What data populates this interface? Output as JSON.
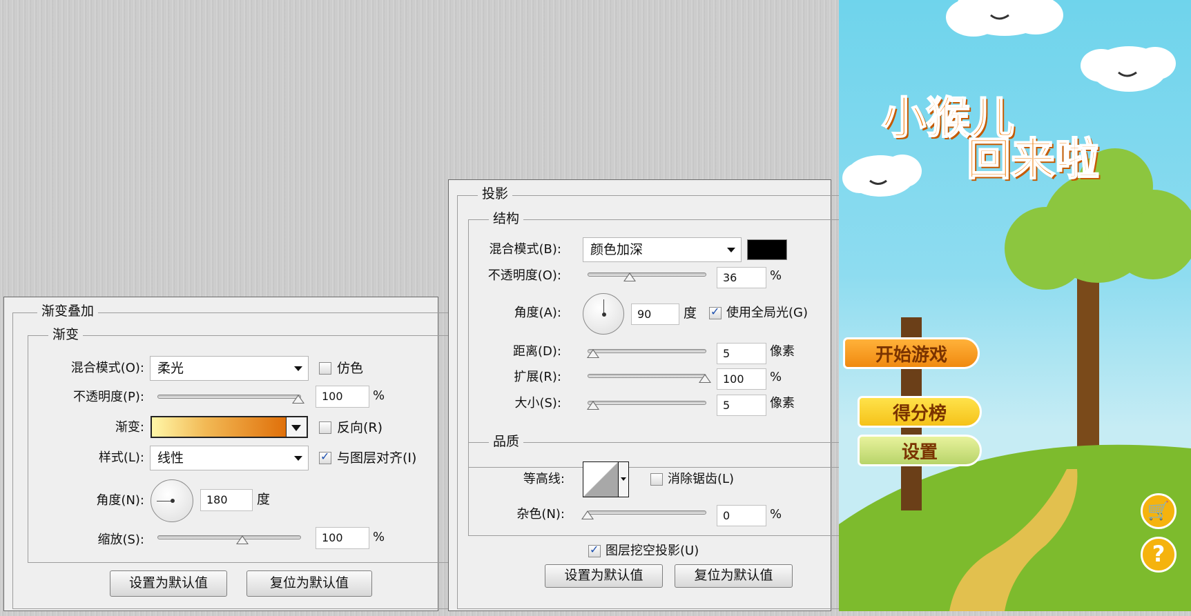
{
  "gradient_overlay": {
    "title": "渐变叠加",
    "section": "渐变",
    "blend_mode_label": "混合模式(O):",
    "blend_mode_value": "柔光",
    "dither_label": "仿色",
    "dither_checked": false,
    "opacity_label": "不透明度(P):",
    "opacity_value": "100",
    "opacity_unit": "%",
    "gradient_label": "渐变:",
    "gradient_colors": [
      "#fff7a8",
      "#f2b955",
      "#e0700a"
    ],
    "reverse_label": "反向(R)",
    "reverse_checked": false,
    "style_label": "样式(L):",
    "style_value": "线性",
    "align_label": "与图层对齐(I)",
    "align_checked": true,
    "angle_label": "角度(N):",
    "angle_value": "180",
    "angle_unit": "度",
    "scale_label": "缩放(S):",
    "scale_value": "100",
    "scale_unit": "%",
    "set_default_label": "设置为默认值",
    "reset_default_label": "复位为默认值"
  },
  "drop_shadow": {
    "title": "投影",
    "structure_section": "结构",
    "blend_mode_label": "混合模式(B):",
    "blend_mode_value": "颜色加深",
    "shadow_color": "#000000",
    "opacity_label": "不透明度(O):",
    "opacity_value": "36",
    "opacity_unit": "%",
    "angle_label": "角度(A):",
    "angle_value": "90",
    "angle_unit": "度",
    "global_light_label": "使用全局光(G)",
    "global_light_checked": true,
    "distance_label": "距离(D):",
    "distance_value": "5",
    "distance_unit": "像素",
    "spread_label": "扩展(R):",
    "spread_value": "100",
    "spread_unit": "%",
    "size_label": "大小(S):",
    "size_value": "5",
    "size_unit": "像素",
    "quality_section": "品质",
    "contour_label": "等高线:",
    "antialias_label": "消除锯齿(L)",
    "antialias_checked": false,
    "noise_label": "杂色(N):",
    "noise_value": "0",
    "noise_unit": "%",
    "knockout_label": "图层挖空投影(U)",
    "knockout_checked": true,
    "set_default_label": "设置为默认值",
    "reset_default_label": "复位为默认值"
  },
  "game": {
    "title_line1": "小猴儿",
    "title_line2": "回来啦",
    "start_button": "开始游戏",
    "leaderboard_button": "得分榜",
    "settings_button": "设置",
    "shop_icon": "cart-icon",
    "help_icon": "question-icon",
    "help_glyph": "?",
    "accent_color": "#f07f10"
  }
}
